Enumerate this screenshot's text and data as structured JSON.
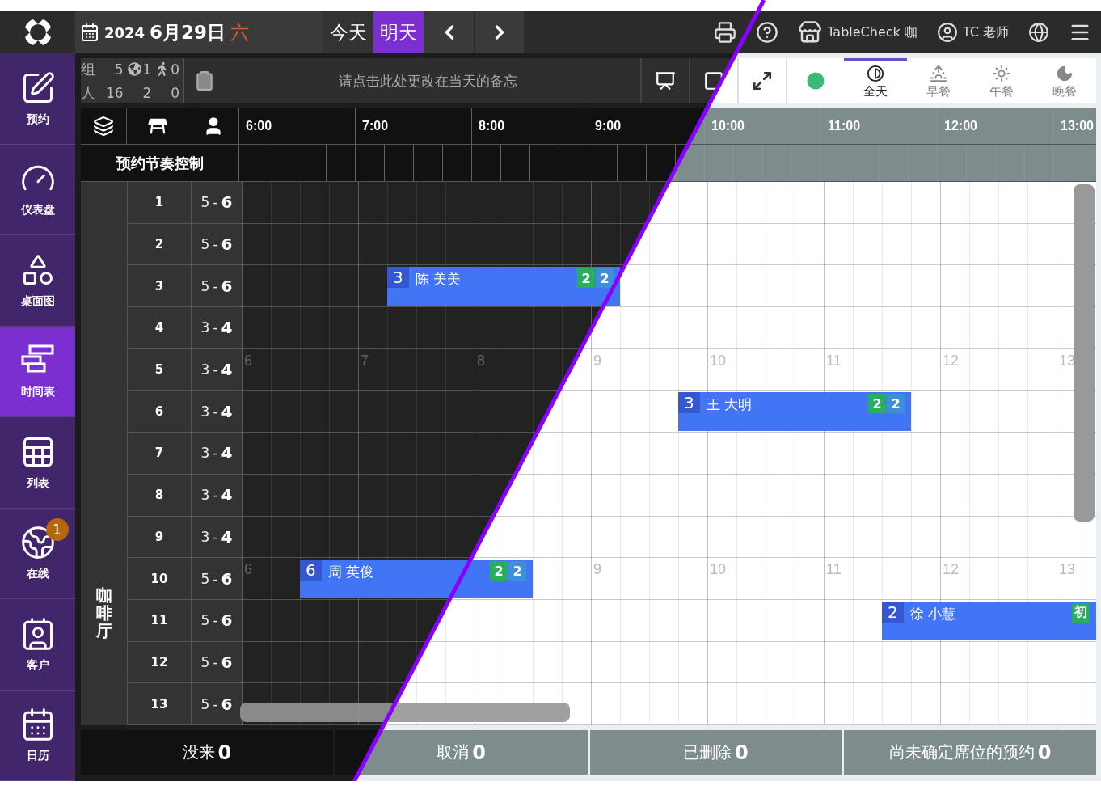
{
  "top_bar": {
    "date": {
      "year": "2024",
      "day": "6月29日",
      "weekday": "六"
    },
    "day_buttons": [
      {
        "label": "今天",
        "selected": false
      },
      {
        "label": "明天",
        "selected": true
      }
    ],
    "store": "TableCheck 咖",
    "user": "TC 老师"
  },
  "sidebar": {
    "items": [
      {
        "label": "预约",
        "kind": "edit",
        "selected": false
      },
      {
        "label": "仪表盘",
        "kind": "dashboard",
        "selected": false
      },
      {
        "label": "桌面图",
        "kind": "floor",
        "selected": false
      },
      {
        "label": "时间表",
        "kind": "timeline",
        "selected": true
      },
      {
        "label": "列表",
        "kind": "list",
        "selected": false
      },
      {
        "label": "在线",
        "kind": "online",
        "selected": false,
        "badge": "1"
      },
      {
        "label": "客户",
        "kind": "customer",
        "selected": false
      },
      {
        "label": "日历",
        "kind": "calendar",
        "selected": false
      }
    ]
  },
  "sub_bar": {
    "count_rows": [
      {
        "label": "组",
        "values": [
          {
            "text": "5",
            "kind": "total"
          },
          {
            "text": "1",
            "kind": "online"
          },
          {
            "text": "0",
            "kind": "walkin"
          }
        ]
      },
      {
        "label": "人",
        "values": [
          {
            "text": "16",
            "kind": "plain"
          },
          {
            "text": "2",
            "kind": "plain"
          },
          {
            "text": "0",
            "kind": "plain"
          }
        ]
      }
    ],
    "memo_prompt": "请点击此处更改在当天的备忘",
    "meal_tabs": [
      {
        "label": "全天",
        "kind": "all",
        "selected": true
      },
      {
        "label": "早餐",
        "kind": "breakfast",
        "selected": false
      },
      {
        "label": "午餐",
        "kind": "lunch",
        "selected": false
      },
      {
        "label": "晚餐",
        "kind": "dinner",
        "selected": false
      }
    ]
  },
  "timeline": {
    "hours": [
      "6:00",
      "7:00",
      "8:00",
      "9:00",
      "10:00",
      "11:00",
      "12:00",
      "13:00"
    ],
    "rhythm_label": "预约节奏控制",
    "area": "咖啡厅",
    "rows": [
      {
        "table": "1",
        "min": "5",
        "sep": "-",
        "max": "6"
      },
      {
        "table": "2",
        "min": "5",
        "sep": "-",
        "max": "6"
      },
      {
        "table": "3",
        "min": "5",
        "sep": "-",
        "max": "6",
        "reservations": [
          {
            "size": "3",
            "name": "陈 美美",
            "tags": [
              {
                "text": "2",
                "color": "#27ae60"
              },
              {
                "text": "2",
                "color": "#3d8fd8"
              }
            ]
          }
        ]
      },
      {
        "table": "4",
        "min": "3",
        "sep": "-",
        "max": "4"
      },
      {
        "table": "5",
        "min": "3",
        "sep": "-",
        "max": "4",
        "hour_marks": [
          "6",
          "7",
          "8",
          "9",
          "10",
          "11",
          "12",
          "13"
        ]
      },
      {
        "table": "6",
        "min": "3",
        "sep": "-",
        "max": "4",
        "reservations": [
          {
            "size": "3",
            "name": "王 大明",
            "tags": [
              {
                "text": "2",
                "color": "#27ae60"
              },
              {
                "text": "2",
                "color": "#3d8fd8"
              }
            ]
          }
        ]
      },
      {
        "table": "7",
        "min": "3",
        "sep": "-",
        "max": "4"
      },
      {
        "table": "8",
        "min": "3",
        "sep": "-",
        "max": "4"
      },
      {
        "table": "9",
        "min": "3",
        "sep": "-",
        "max": "4"
      },
      {
        "table": "10",
        "min": "5",
        "sep": "-",
        "max": "6",
        "hour_marks": [
          "6",
          "9",
          "10",
          "11",
          "12",
          "13"
        ],
        "reservations": [
          {
            "size": "6",
            "name": "周 英俊",
            "tags": [
              {
                "text": "2",
                "color": "#27ae60"
              },
              {
                "text": "2",
                "color": "#3d8fd8"
              }
            ]
          }
        ]
      },
      {
        "table": "11",
        "min": "5",
        "sep": "-",
        "max": "6",
        "reservations": [
          {
            "size": "2",
            "name": "徐 小慧",
            "tags": [
              {
                "text": "初",
                "color": "#27ae60"
              }
            ]
          }
        ]
      },
      {
        "table": "12",
        "min": "5",
        "sep": "-",
        "max": "6"
      },
      {
        "table": "13",
        "min": "5",
        "sep": "-",
        "max": "6"
      }
    ]
  },
  "status_bar": [
    {
      "label": "没来",
      "count": "0"
    },
    {
      "label": "取消",
      "count": "0"
    },
    {
      "label": "已删除",
      "count": "0"
    },
    {
      "label": "尚未确定席位的预约",
      "count": "0"
    }
  ]
}
